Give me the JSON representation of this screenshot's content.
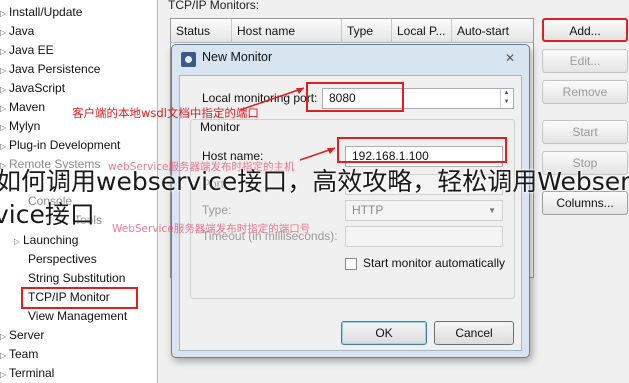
{
  "tree": {
    "items": [
      {
        "label": "Install/Update",
        "arrow": "▷"
      },
      {
        "label": "Java",
        "arrow": "▷"
      },
      {
        "label": "Java EE",
        "arrow": "▷"
      },
      {
        "label": "Java Persistence",
        "arrow": "▷"
      },
      {
        "label": "JavaScript",
        "arrow": "▷"
      },
      {
        "label": "Maven",
        "arrow": "▷"
      },
      {
        "label": "Mylyn",
        "arrow": "▷"
      },
      {
        "label": "Plug-in Development",
        "arrow": "▷"
      },
      {
        "label": "Remote Systems",
        "arrow": "▷"
      },
      {
        "label": "Console",
        "arrow": ""
      },
      {
        "label": "Tools",
        "arrow": ""
      },
      {
        "label": "Launching",
        "arrow": "▷"
      },
      {
        "label": "Perspectives",
        "arrow": ""
      },
      {
        "label": "String Substitution",
        "arrow": ""
      },
      {
        "label": "TCP/IP Monitor",
        "arrow": ""
      },
      {
        "label": "View Management",
        "arrow": ""
      },
      {
        "label": "Server",
        "arrow": "▷"
      },
      {
        "label": "Team",
        "arrow": "▷"
      },
      {
        "label": "Terminal",
        "arrow": "▷"
      }
    ]
  },
  "pane": {
    "title": "TCP/IP Monitors:",
    "columns": [
      "Status",
      "Host name",
      "Type",
      "Local P...",
      "Auto-start"
    ],
    "buttons": {
      "add": "Add...",
      "edit": "Edit...",
      "remove": "Remove",
      "start": "Start",
      "stop": "Stop",
      "columns": "Columns..."
    }
  },
  "dialog": {
    "title": "New Monitor",
    "close": "✕",
    "local_port_label": "Local monitoring port:",
    "local_port_value": "8080",
    "group_label": "Monitor",
    "host_label": "Host name:",
    "host_value": "192.168.1.100",
    "port_label": "Port:",
    "type_label": "Type:",
    "type_value": "HTTP",
    "timeout_label": "Timeout (in milliseconds):",
    "autostart_label": "Start monitor automatically",
    "ok": "OK",
    "cancel": "Cancel"
  },
  "annotations": {
    "client_port": "客户端的本地wsdl文档中指定的端口",
    "server_host": "webService服务器端发布时指定的主机",
    "server_port": "WebService服务器端发布时指定的端口号"
  },
  "overlay": {
    "line1": "如何调用webservice接口，高效攻略，轻松调用Webser",
    "line2": "vice接口"
  },
  "colors": {
    "annotation_red": "#e02020",
    "dialog_frame": "#d9e4f1"
  }
}
